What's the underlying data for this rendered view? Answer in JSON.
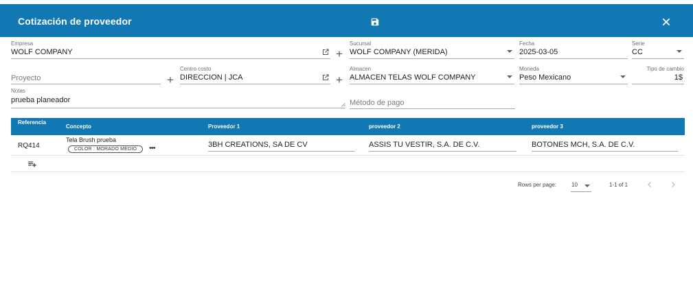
{
  "header": {
    "title": "Cotización de proveedor",
    "save_icon": "save-icon",
    "close_icon": "close-icon"
  },
  "form": {
    "empresa": {
      "label": "Empresa",
      "value": "WOLF COMPANY"
    },
    "sucursal": {
      "label": "Sucursal",
      "value": "WOLF COMPANY (MERIDA)"
    },
    "fecha": {
      "label": "Fecha",
      "value": "2025-03-05"
    },
    "serie": {
      "label": "Serie",
      "value": "CC"
    },
    "proyecto": {
      "placeholder": "Proyecto"
    },
    "centro_costo": {
      "label": "Centro costo",
      "value": "DIRECCION | JCA"
    },
    "almacen": {
      "label": "Almacen",
      "value": "ALMACEN TELAS WOLF COMPANY"
    },
    "moneda": {
      "label": "Moneda",
      "value": "Peso Mexicano"
    },
    "tipo_cambio": {
      "label": "Tipo de cambio",
      "value": "1$"
    },
    "notas": {
      "label": "Notas",
      "value": "prueba planeador"
    },
    "metodo_pago": {
      "placeholder": "Método de pago"
    }
  },
  "table": {
    "columns": [
      "Referencia",
      "Concepto",
      "Proveedor 1",
      "proveedor 2",
      "proveedor 3"
    ],
    "rows": [
      {
        "referencia": "RQ414",
        "concepto": "Tela Brush prueba",
        "chip": "COLOR : MORADO MEDIO",
        "proveedor1": "3BH CREATIONS, SA DE CV",
        "proveedor2": "ASSIS TU VESTIR, S.A. DE C.V.",
        "proveedor3": "BOTONES MCH, S.A. DE C.V."
      }
    ],
    "add_row_icon": "playlist-add-icon"
  },
  "pagination": {
    "rows_per_page_label": "Rows per page:",
    "rows_per_page": "10",
    "range": "1-1 of 1"
  },
  "colors": {
    "primary": "#1178b4",
    "text": "#212121",
    "muted": "#6f6f6f"
  }
}
